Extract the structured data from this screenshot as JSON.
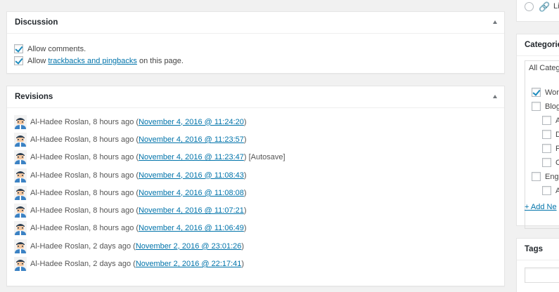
{
  "discussion": {
    "title": "Discussion",
    "allow_comments": {
      "label": "Allow comments.",
      "checked": true
    },
    "allow_pings": {
      "prefix": "Allow ",
      "link": "trackbacks and pingbacks",
      "suffix": " on this page.",
      "checked": true
    }
  },
  "revisions": {
    "title": "Revisions",
    "items": [
      {
        "author_time": "Al-Hadee Roslan, 8 hours ago (",
        "link": "November 4, 2016 @ 11:24:20",
        "suffix": ")"
      },
      {
        "author_time": "Al-Hadee Roslan, 8 hours ago (",
        "link": "November 4, 2016 @ 11:23:57",
        "suffix": ")"
      },
      {
        "author_time": "Al-Hadee Roslan, 8 hours ago (",
        "link": "November 4, 2016 @ 11:23:47",
        "suffix": ") [Autosave]"
      },
      {
        "author_time": "Al-Hadee Roslan, 8 hours ago (",
        "link": "November 4, 2016 @ 11:08:43",
        "suffix": ")"
      },
      {
        "author_time": "Al-Hadee Roslan, 8 hours ago (",
        "link": "November 4, 2016 @ 11:08:08",
        "suffix": ")"
      },
      {
        "author_time": "Al-Hadee Roslan, 8 hours ago (",
        "link": "November 4, 2016 @ 11:07:21",
        "suffix": ")"
      },
      {
        "author_time": "Al-Hadee Roslan, 8 hours ago (",
        "link": "November 4, 2016 @ 11:06:49",
        "suffix": ")"
      },
      {
        "author_time": "Al-Hadee Roslan, 2 days ago (",
        "link": "November 2, 2016 @ 23:01:26",
        "suffix": ")"
      },
      {
        "author_time": "Al-Hadee Roslan, 2 days ago (",
        "link": "November 2, 2016 @ 22:17:41",
        "suffix": ")"
      }
    ]
  },
  "sidebar": {
    "format_label": "Li",
    "categories": {
      "title": "Categorie",
      "tab_label": "All Categ",
      "items": [
        {
          "label": "Wor",
          "checked": true
        },
        {
          "label": "Blog",
          "checked": false
        },
        {
          "label": "A",
          "checked": false
        },
        {
          "label": "D",
          "checked": false
        },
        {
          "label": "F",
          "checked": false
        },
        {
          "label": "C",
          "checked": false
        },
        {
          "label": "Eng",
          "checked": false
        },
        {
          "label": "A",
          "checked": false
        }
      ],
      "add_new": "+ Add Ne"
    },
    "tags": {
      "title": "Tags"
    }
  },
  "colors": {
    "link": "#0073aa",
    "checkmark": "#1e8cbe",
    "background": "#f1f1f1"
  }
}
